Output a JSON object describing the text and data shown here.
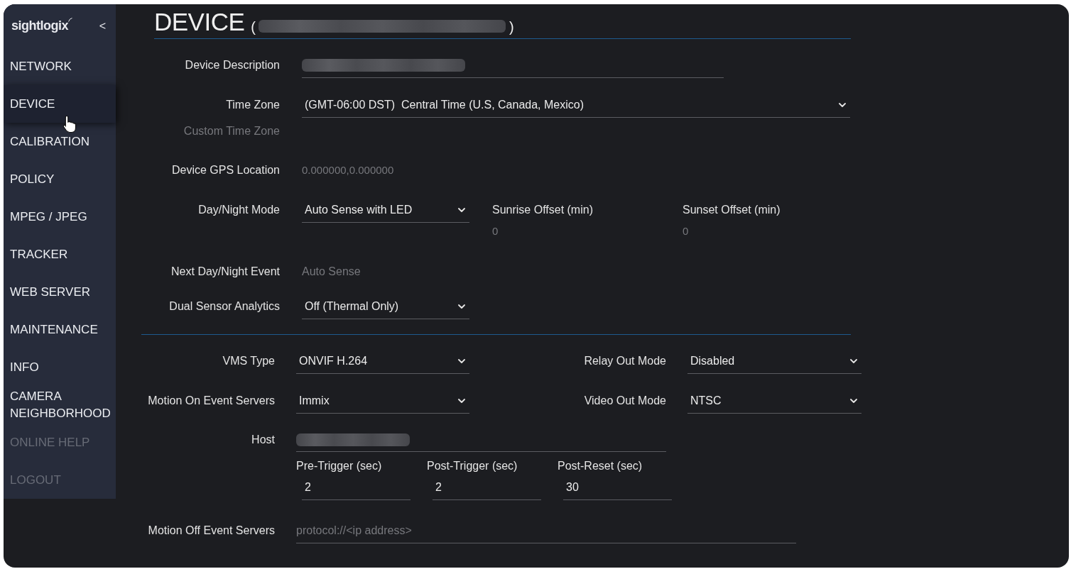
{
  "sidebar": {
    "logo": "sightlogix",
    "collapse_button": "<",
    "items": [
      {
        "label": "NETWORK",
        "selected": false,
        "disabled": false
      },
      {
        "label": "DEVICE",
        "selected": true,
        "disabled": false
      },
      {
        "label": "CALIBRATION",
        "selected": false,
        "disabled": false
      },
      {
        "label": "POLICY",
        "selected": false,
        "disabled": false
      },
      {
        "label": "MPEG / JPEG",
        "selected": false,
        "disabled": false
      },
      {
        "label": "TRACKER",
        "selected": false,
        "disabled": false
      },
      {
        "label": "WEB SERVER",
        "selected": false,
        "disabled": false
      },
      {
        "label": "MAINTENANCE",
        "selected": false,
        "disabled": false
      },
      {
        "label": "INFO",
        "selected": false,
        "disabled": false
      },
      {
        "label": "CAMERA NEIGHBORHOOD",
        "selected": false,
        "disabled": false
      },
      {
        "label": "ONLINE HELP",
        "selected": false,
        "disabled": true
      },
      {
        "label": "LOGOUT",
        "selected": false,
        "disabled": true
      }
    ]
  },
  "header": {
    "title": "DEVICE",
    "open_paren": "(",
    "id_blurred": true,
    "close_paren": ")"
  },
  "device_description": {
    "label": "Device Description",
    "value_blurred": true
  },
  "time_zone": {
    "label": "Time Zone",
    "value": "(GMT-06:00 DST)  Central Time (U.S, Canada, Mexico)"
  },
  "custom_time_zone": {
    "label": "Custom Time Zone",
    "disabled": true
  },
  "gps_location": {
    "label": "Device GPS Location",
    "value": "0.000000,0.000000",
    "readonly": true
  },
  "day_night_mode": {
    "label": "Day/Night Mode",
    "value": "Auto Sense with LED",
    "offsets": [
      {
        "label": "Sunrise Offset (min)",
        "value": "0",
        "readonly": true
      },
      {
        "label": "Sunset Offset (min)",
        "value": "0",
        "readonly": true
      }
    ]
  },
  "next_day_night_event": {
    "label": "Next Day/Night Event",
    "value": "Auto Sense",
    "readonly": true
  },
  "dual_sensor_analytics": {
    "label": "Dual Sensor Analytics",
    "value": "Off (Thermal Only)"
  },
  "vms_type": {
    "label": "VMS Type",
    "value": "ONVIF H.264"
  },
  "relay_out_mode": {
    "label": "Relay Out Mode",
    "value": "Disabled"
  },
  "motion_on_event_servers": {
    "label": "Motion On Event Servers",
    "value": "Immix"
  },
  "video_out_mode": {
    "label": "Video Out Mode",
    "value": "NTSC"
  },
  "host": {
    "label": "Host",
    "value_blurred": true
  },
  "triggers": [
    {
      "label": "Pre-Trigger (sec)",
      "value": "2"
    },
    {
      "label": "Post-Trigger (sec)",
      "value": "2"
    },
    {
      "label": "Post-Reset (sec)",
      "value": "30"
    }
  ],
  "motion_off_event_servers": {
    "label": "Motion Off Event Servers",
    "placeholder": "protocol://<ip address>"
  }
}
